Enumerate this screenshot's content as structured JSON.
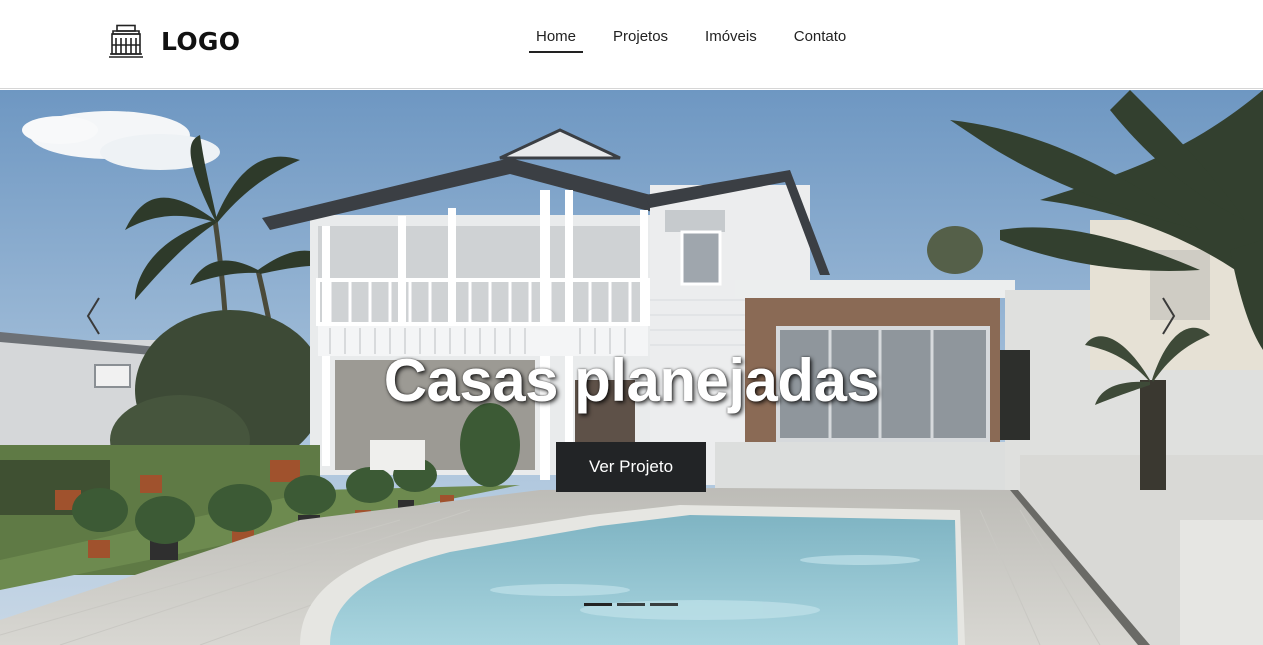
{
  "header": {
    "logo_text": "LOGO",
    "logo_icon": "building-icon",
    "nav": [
      {
        "label": "Home",
        "active": true
      },
      {
        "label": "Projetos",
        "active": false
      },
      {
        "label": "Imóveis",
        "active": false
      },
      {
        "label": "Contato",
        "active": false
      }
    ]
  },
  "hero": {
    "title": "Casas planejadas",
    "button_label": "Ver Projeto",
    "prev_icon": "chevron-left-icon",
    "next_icon": "chevron-right-icon",
    "slide_count": 3,
    "active_slide": 1
  },
  "colors": {
    "button_bg": "#222426",
    "title_text": "#ffffff",
    "header_bg": "#ffffff"
  }
}
